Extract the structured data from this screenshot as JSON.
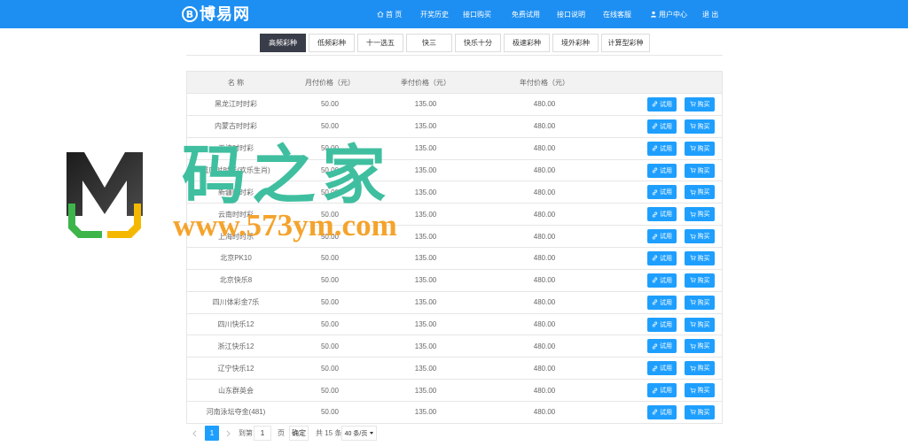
{
  "colors": {
    "primary": "#1E8FF2",
    "button": "#1E9FFF",
    "active_tab": "#393D49",
    "brand_watermark": "#3FBF9F",
    "url_watermark": "#F4A32C"
  },
  "header": {
    "logo_letter": "B",
    "logo_text": "博易网",
    "nav": [
      {
        "label": "首 页",
        "icon": "home-icon"
      },
      {
        "label": "开奖历史"
      },
      {
        "label": "接口购买"
      },
      {
        "label": "免费试用"
      },
      {
        "label": "接口说明"
      },
      {
        "label": "在线客服"
      },
      {
        "label": "用户中心",
        "icon": "user-icon"
      },
      {
        "label": "退 出"
      }
    ]
  },
  "tabs": [
    {
      "label": "高频彩种",
      "active": true
    },
    {
      "label": "低频彩种"
    },
    {
      "label": "十一选五"
    },
    {
      "label": "快三"
    },
    {
      "label": "快乐十分"
    },
    {
      "label": "极速彩种"
    },
    {
      "label": "境外彩种"
    },
    {
      "label": "计算型彩种"
    }
  ],
  "table": {
    "columns": {
      "name": "名 称",
      "monthly": "月付价格（元）",
      "quarterly": "季付价格（元）",
      "yearly": "年付价格（元）"
    },
    "trial_label": "试用",
    "trial_icon": "link-icon",
    "buy_label": "购买",
    "buy_icon": "cart-icon",
    "rows": [
      {
        "name": "黑龙江时时彩",
        "monthly": "50.00",
        "quarterly": "135.00",
        "yearly": "480.00"
      },
      {
        "name": "内蒙古时时彩",
        "monthly": "50.00",
        "quarterly": "135.00",
        "yearly": "480.00"
      },
      {
        "name": "天津时时彩",
        "monthly": "50.00",
        "quarterly": "135.00",
        "yearly": "480.00"
      },
      {
        "name": "重庆时时彩(欢乐生肖)",
        "monthly": "50.00",
        "quarterly": "135.00",
        "yearly": "480.00"
      },
      {
        "name": "新疆时时彩",
        "monthly": "50.00",
        "quarterly": "135.00",
        "yearly": "480.00"
      },
      {
        "name": "云南时时彩",
        "monthly": "50.00",
        "quarterly": "135.00",
        "yearly": "480.00"
      },
      {
        "name": "上海时时乐",
        "monthly": "50.00",
        "quarterly": "135.00",
        "yearly": "480.00"
      },
      {
        "name": "北京PK10",
        "monthly": "50.00",
        "quarterly": "135.00",
        "yearly": "480.00"
      },
      {
        "name": "北京快乐8",
        "monthly": "50.00",
        "quarterly": "135.00",
        "yearly": "480.00"
      },
      {
        "name": "四川体彩金7乐",
        "monthly": "50.00",
        "quarterly": "135.00",
        "yearly": "480.00"
      },
      {
        "name": "四川快乐12",
        "monthly": "50.00",
        "quarterly": "135.00",
        "yearly": "480.00"
      },
      {
        "name": "浙江快乐12",
        "monthly": "50.00",
        "quarterly": "135.00",
        "yearly": "480.00"
      },
      {
        "name": "辽宁快乐12",
        "monthly": "50.00",
        "quarterly": "135.00",
        "yearly": "480.00"
      },
      {
        "name": "山东群英会",
        "monthly": "50.00",
        "quarterly": "135.00",
        "yearly": "480.00"
      },
      {
        "name": "河南泳坛夺金(481)",
        "monthly": "50.00",
        "quarterly": "135.00",
        "yearly": "480.00"
      }
    ]
  },
  "pagination": {
    "current_page": "1",
    "goto_prefix": "到第",
    "goto_value": "1",
    "goto_suffix": "页",
    "confirm_label": "确定",
    "total": "共 15 条",
    "page_size": "40 条/页"
  },
  "watermark": {
    "logo_icon": "m-logo-icon",
    "brand": "码之家",
    "url": "www.573ym.com"
  }
}
